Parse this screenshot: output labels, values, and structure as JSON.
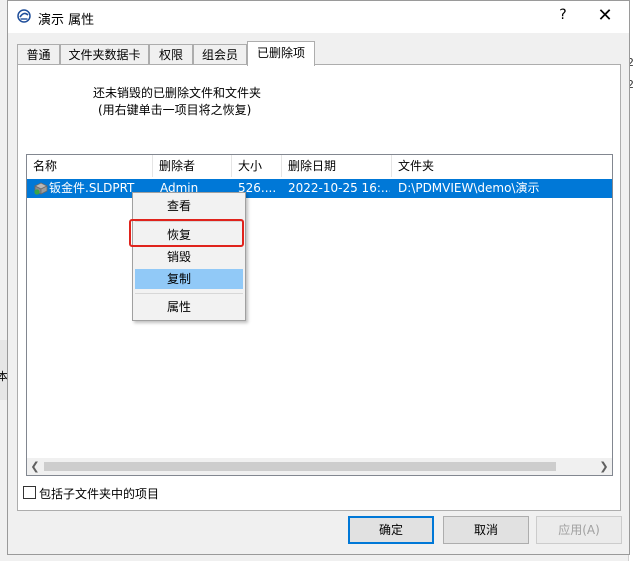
{
  "background": {
    "right_fragment_1": "2",
    "right_fragment_2": "2",
    "left_fragment": "本"
  },
  "dialog": {
    "title": "演示 属性",
    "help_label": "?",
    "close_label": "✕"
  },
  "tabs": [
    {
      "label": "普通"
    },
    {
      "label": "文件夹数据卡"
    },
    {
      "label": "权限"
    },
    {
      "label": "组会员"
    },
    {
      "label": "已删除项"
    }
  ],
  "info": {
    "line1": "还未销毁的已删除文件和文件夹",
    "line2": "(用右键单击一项目将之恢复)"
  },
  "list": {
    "columns": [
      "名称",
      "删除者",
      "大小",
      "删除日期",
      "文件夹"
    ],
    "rows": [
      {
        "name": "钣金件.SLDPRT",
        "deleted_by": "Admin",
        "size": "526....",
        "date": "2022-10-25 16:...",
        "folder": "D:\\PDMVIEW\\demo\\演示"
      }
    ]
  },
  "context_menu": {
    "items": [
      "查看",
      "恢复",
      "销毁",
      "复制",
      "属性"
    ]
  },
  "include_subfolders_label": "包括子文件夹中的项目",
  "buttons": {
    "ok": "确定",
    "cancel": "取消",
    "apply": "应用(A)"
  },
  "colors": {
    "selection": "#0078d7",
    "highlight_box": "#e0231c",
    "menu_hover": "#91c9f7"
  }
}
